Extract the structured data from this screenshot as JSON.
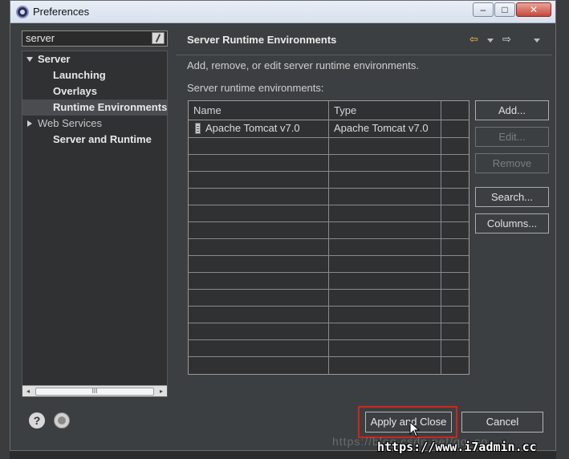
{
  "window": {
    "title": "Preferences",
    "minimize_glyph": "–",
    "maximize_glyph": "□",
    "close_glyph": "✕"
  },
  "filter": {
    "value": "server"
  },
  "tree": {
    "items": [
      {
        "label": "Server",
        "expanded": true
      },
      {
        "label": "Launching"
      },
      {
        "label": "Overlays"
      },
      {
        "label": "Runtime Environments",
        "selected": true
      },
      {
        "label": "Web Services",
        "expanded": false
      },
      {
        "label": "Server and Runtime"
      }
    ],
    "scroll_glyphs": {
      "left": "◂",
      "thumb": "III",
      "right": "▸"
    }
  },
  "page": {
    "title": "Server Runtime Environments",
    "description": "Add, remove, or edit server runtime environments.",
    "table_label": "Server runtime environments:",
    "nav_back_glyph": "⇦",
    "nav_forward_glyph": "⇨"
  },
  "table": {
    "columns": [
      "Name",
      "Type"
    ],
    "rows": [
      {
        "name": "Apache Tomcat v7.0",
        "type": "Apache Tomcat v7.0"
      }
    ]
  },
  "buttons": {
    "add": "Add...",
    "edit": "Edit...",
    "remove": "Remove",
    "search": "Search...",
    "columns": "Columns...",
    "apply_close": "Apply and Close",
    "cancel": "Cancel"
  },
  "footer": {
    "help_glyph": "?"
  },
  "watermark": {
    "faint": "https://blog.csdn.net/qq_so",
    "main": "https://www.i7admin.cc"
  },
  "colors": {
    "background": "#3c3f41",
    "highlight_box": "#d0241c",
    "nav_back_arrow": "#f0c24a"
  }
}
